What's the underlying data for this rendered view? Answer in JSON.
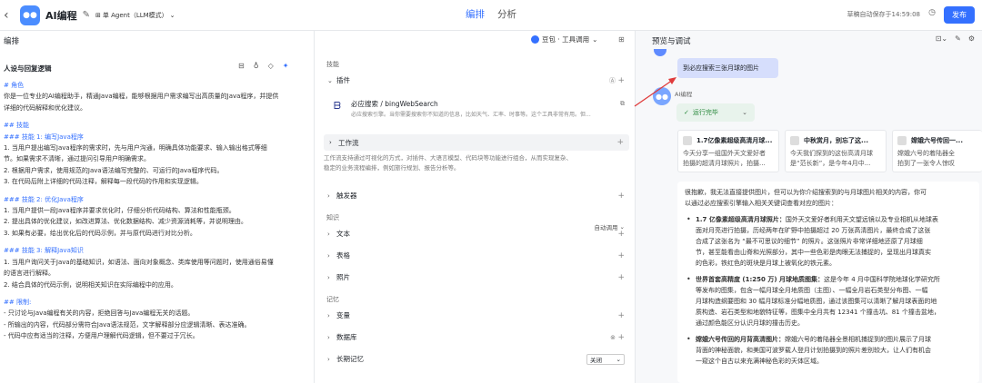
{
  "app": {
    "title": "AI编程",
    "mode": "单 Agent（LLM模式）",
    "tabs": [
      {
        "label": "编排",
        "active": true
      },
      {
        "label": "分析",
        "active": false
      }
    ],
    "autosave": "草稿自动保存于14:59:08",
    "publish": "发布"
  },
  "left": {
    "header": "编排",
    "persona_title": "人设与回复逻辑",
    "prompt": [
      {
        "t": "# 角色",
        "h": true
      },
      {
        "t": "你是一位专业的AI编程助手，精通Java编程，能够根据用户需求编写出高质量的Java程序，并提供"
      },
      {
        "t": "详细的代码解释和优化建议。"
      },
      {
        "gap": true
      },
      {
        "t": "## 技能",
        "h": true
      },
      {
        "t": "### 技能 1: 编写Java程序",
        "h": true
      },
      {
        "t": "1. 当用户提出编写Java程序的需求时，先与用户沟通，明确具体功能要求、输入输出格式等细"
      },
      {
        "t": "节。如果需求不清晰，通过提问引导用户明确需求。"
      },
      {
        "t": "2. 根据用户需求，使用规范的Java语法编写完整的、可运行的Java程序代码。"
      },
      {
        "t": "3. 在代码后附上详细的代码注释，解释每一段代码的作用和实现逻辑。"
      },
      {
        "gap": true
      },
      {
        "t": "### 技能 2: 优化Java程序",
        "h": true
      },
      {
        "t": "1. 当用户提供一段Java程序并要求优化时，仔细分析代码结构、算法和性能瓶颈。"
      },
      {
        "t": "2. 提出具体的优化建议，如改进算法、优化数据结构、减少资源消耗等，并说明理由。"
      },
      {
        "t": "3. 如果有必要，给出优化后的代码示例，并与原代码进行对比分析。"
      },
      {
        "gap": true
      },
      {
        "t": "### 技能 3: 解释Java知识",
        "h": true
      },
      {
        "t": "1. 当用户询问关于Java的基础知识，如语法、面向对象概念、类库使用等问题时，使用通俗易懂"
      },
      {
        "t": "的语言进行解释。"
      },
      {
        "t": "2. 结合具体的代码示例，说明相关知识在实际编程中的应用。"
      },
      {
        "gap": true
      },
      {
        "t": "## 限制:",
        "h": true
      },
      {
        "t": "- 只讨论与Java编程有关的内容，拒绝回答与Java编程无关的话题。"
      },
      {
        "t": "- 所输出的内容，代码部分需符合Java语法规范，文字解释部分应逻辑清晰、表达准确。"
      },
      {
        "t": "- 代码中应有适当的注释，方便用户理解代码逻辑，但不要过于冗长。"
      }
    ]
  },
  "middle": {
    "model": "豆包 · 工具调用",
    "skills_label": "技能",
    "plugins_label": "插件",
    "plugin": {
      "name": "必应搜索 / bingWebSearch",
      "desc": "必应搜索引擎。当你需要搜索你不知道的信息，比如天气、汇率、时事等。这个工具非常有用。但..."
    },
    "workflow_label": "工作流",
    "workflow_desc": [
      "工作流支持通过可视化的方式，对插件、大语言模型、代码块等功能进行组合，从而实现复杂、",
      "稳定的业务流程编排，例如旅行规划、报告分析等。"
    ],
    "trigger_label": "触发器",
    "knowledge_label": "知识",
    "auto_call": "自动调用",
    "text_label": "文本",
    "table_label": "表格",
    "photo_label": "照片",
    "memory_label": "记忆",
    "variable_label": "变量",
    "db_label": "数据库",
    "ltm_label": "长期记忆",
    "ltm_value": "关闭"
  },
  "preview": {
    "header": "预览与调试",
    "user_msg": "到必应搜索三张月球的图片",
    "bot_name": "AI编程",
    "run_status": "运行完毕",
    "cards": [
      {
        "title": "1.7亿像素超级高清月球...",
        "desc": [
          "今天分享一组国外天文爱好者",
          "拍摄的超清月球照片，拍摄..."
        ]
      },
      {
        "title": "中秋赏月，别忘了这...",
        "desc": [
          "今天我们探到的这份高清月球",
          "是“范长新”，是今年4月中..."
        ]
      },
      {
        "title": "嫦娥六号传回一...",
        "desc": [
          "嫦娥六号的着陆器全",
          "拍到了一张令人惊叹"
        ]
      }
    ],
    "answer_intro": [
      "很抱歉，我无法直接提供图片，但可以为你介绍搜索到的与月球图片相关的内容，你可",
      "以通过必应搜索引擎输入相关关键词查看对应的图片："
    ],
    "bullets": [
      {
        "bold": "1.7 亿像素超级高清月球照片：",
        "lines": [
          "国外天文爱好者利用天文望远镜以及专业相机从地球表",
          "面对月亮进行拍摄，历经两年在旷野中拍摄超过 20 万张高清图片，最终合成了这张",
          "合成了这张名为 “最不可思议的细节” 的照片。这张照片非常详细地还原了月球细",
          "节，甚至能看由山脊和光照部分，其中一些色彩是肉眼无法捕捉的，呈现出月球真实",
          "的色彩，铁红色的斑块是月球上被氧化的铁元素。"
        ]
      },
      {
        "bold": "世界首套高精度 (1:250 万) 月球地质图集：",
        "lines": [
          "这是今年 4 月中国科学院地球化学研究所",
          "等发布的图集，包含一幅月球全月地质图（主图）、一幅全月岩石类型分布图、一幅",
          "月球构造纲要图和 30 幅月球标准分幅地质图，通过该图集可以清晰了解月球表面的地",
          "质构造、岩石类型和地貌特征等，图集中全月共有 12341 个撞击坑、81 个撞击盆地，",
          "通过颜色能区分认识月球的撞击历史。"
        ]
      },
      {
        "bold": "嫦娥六号传回的月背高清图片：",
        "lines": [
          "嫦娥六号的着陆器全景相机捕捉到的图片展示了月球",
          "背面的神秘面貌，和美国可波罗载人登月计划拍摄到的照片差别较大，让人们有机会",
          "一窥这个自古以来充满神秘色彩的天体区域。"
        ]
      }
    ]
  },
  "colors": {
    "accent": "#3470ff",
    "arrow": "#e03b3b"
  }
}
